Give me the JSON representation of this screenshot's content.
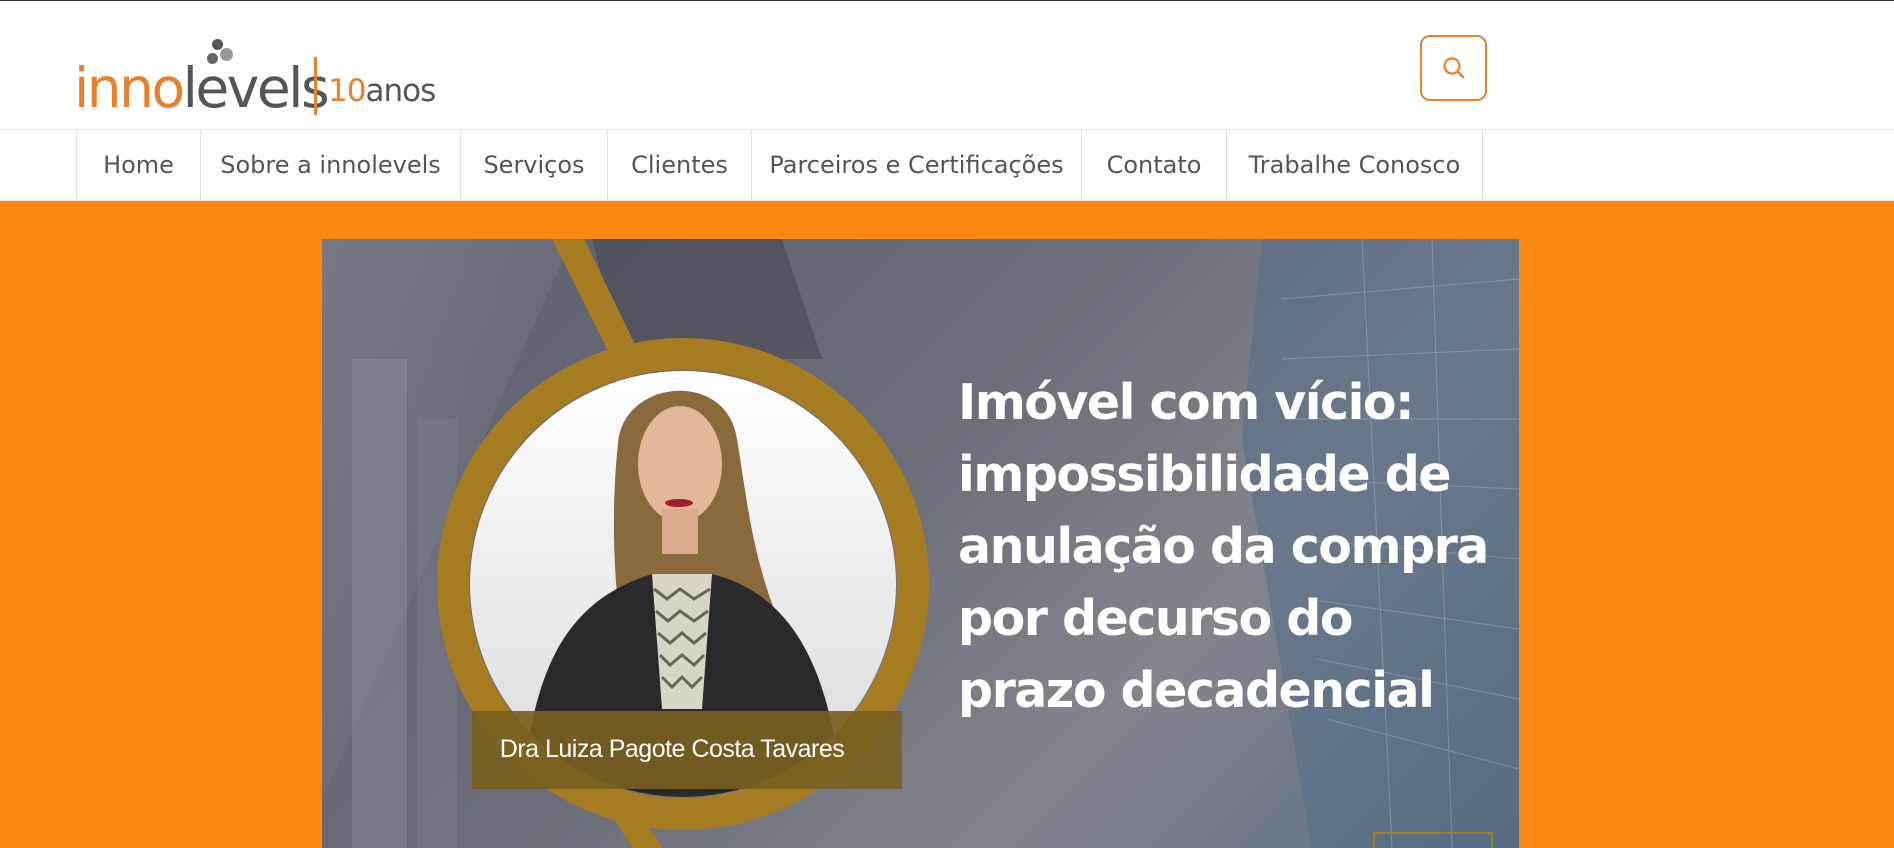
{
  "brand": {
    "name_part1": "inno",
    "name_part2": "levels",
    "years_number": "10",
    "years_label": "anos"
  },
  "header": {
    "search_icon": "search-icon"
  },
  "nav": {
    "items": [
      {
        "label": "Home"
      },
      {
        "label": "Sobre a innolevels"
      },
      {
        "label": "Serviços"
      },
      {
        "label": "Clientes"
      },
      {
        "label": "Parceiros e Certificações"
      },
      {
        "label": "Contato"
      },
      {
        "label": "Trabalhe Conosco"
      }
    ]
  },
  "banner": {
    "title": "Imóvel com vício: impossibilidade de anulação da compra por decurso do prazo decadencial",
    "author_name": "Dra Luiza Pagote Costa Tavares"
  },
  "colors": {
    "accent": "#e8812a",
    "hero_background": "#fb8811",
    "gold_ring": "#a67c22",
    "text_dark": "#555555"
  }
}
